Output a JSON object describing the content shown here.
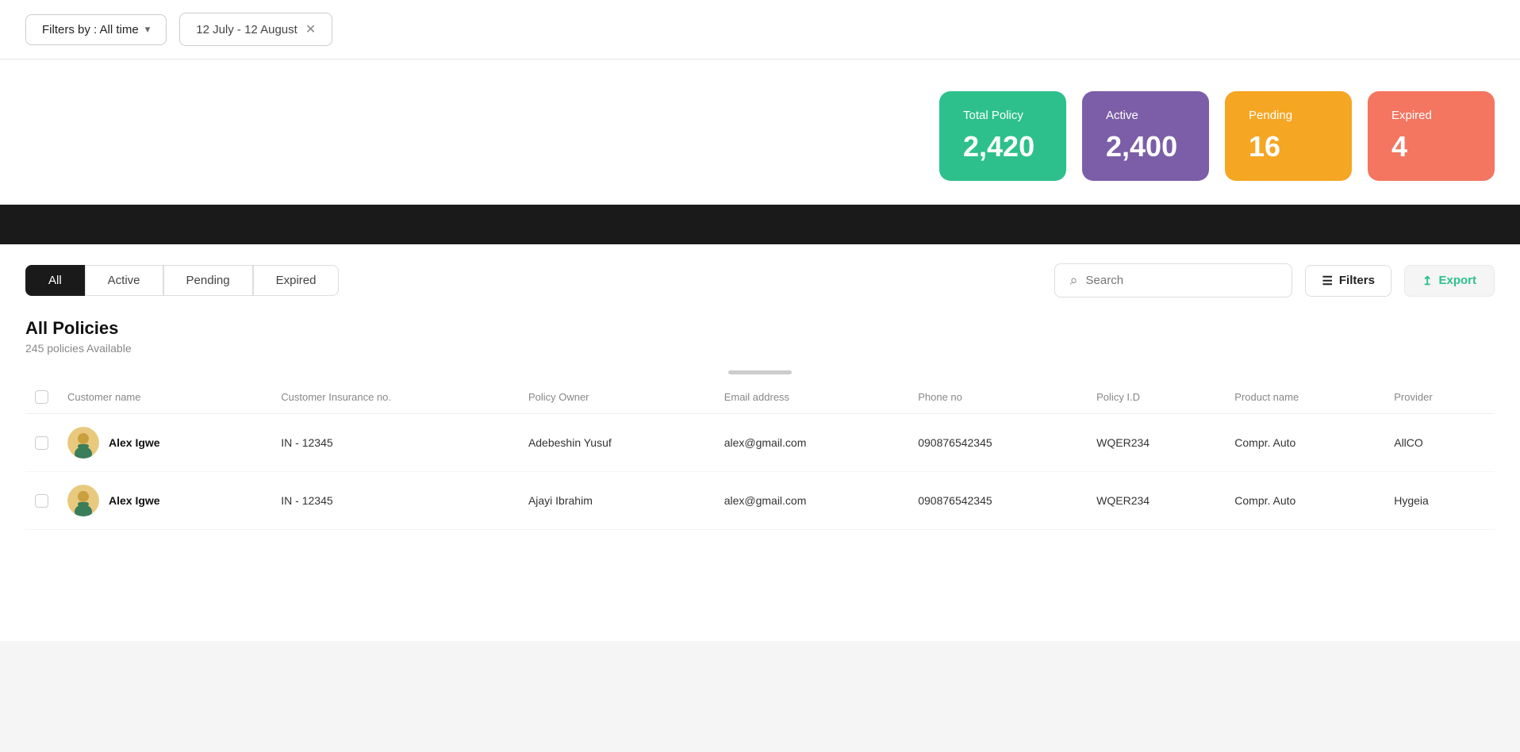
{
  "topBar": {
    "filterLabel": "Filters by : All time",
    "filterChevron": "▾",
    "dateRange": "12 July - 12 August",
    "dateClose": "✕"
  },
  "stats": [
    {
      "id": "total",
      "label": "Total Policy",
      "value": "2,420",
      "colorClass": "stat-total"
    },
    {
      "id": "active",
      "label": "Active",
      "value": "2,400",
      "colorClass": "stat-active"
    },
    {
      "id": "pending",
      "label": "Pending",
      "value": "16",
      "colorClass": "stat-pending"
    },
    {
      "id": "expired",
      "label": "Expired",
      "value": "4",
      "colorClass": "stat-expired"
    }
  ],
  "tabs": [
    {
      "id": "all",
      "label": "All",
      "active": true
    },
    {
      "id": "active",
      "label": "Active",
      "active": false
    },
    {
      "id": "pending",
      "label": "Pending",
      "active": false
    },
    {
      "id": "expired",
      "label": "Expired",
      "active": false
    }
  ],
  "search": {
    "placeholder": "Search"
  },
  "toolbar": {
    "filtersLabel": "Filters",
    "exportLabel": "Export"
  },
  "table": {
    "title": "All Policies",
    "subtitle": "245 policies Available",
    "columns": [
      "Customer name",
      "Customer Insurance no.",
      "Policy Owner",
      "Email address",
      "Phone no",
      "Policy I.D",
      "Product name",
      "Provider"
    ],
    "rows": [
      {
        "name": "Alex Igwe",
        "insurance": "IN - 12345",
        "owner": "Adebeshin Yusuf",
        "email": "alex@gmail.com",
        "phone": "090876542345",
        "policyId": "WQER234",
        "product": "Compr. Auto",
        "provider": "AllCO"
      },
      {
        "name": "Alex Igwe",
        "insurance": "IN - 12345",
        "owner": "Ajayi Ibrahim",
        "email": "alex@gmail.com",
        "phone": "090876542345",
        "policyId": "WQER234",
        "product": "Compr. Auto",
        "provider": "Hygeia"
      }
    ]
  }
}
